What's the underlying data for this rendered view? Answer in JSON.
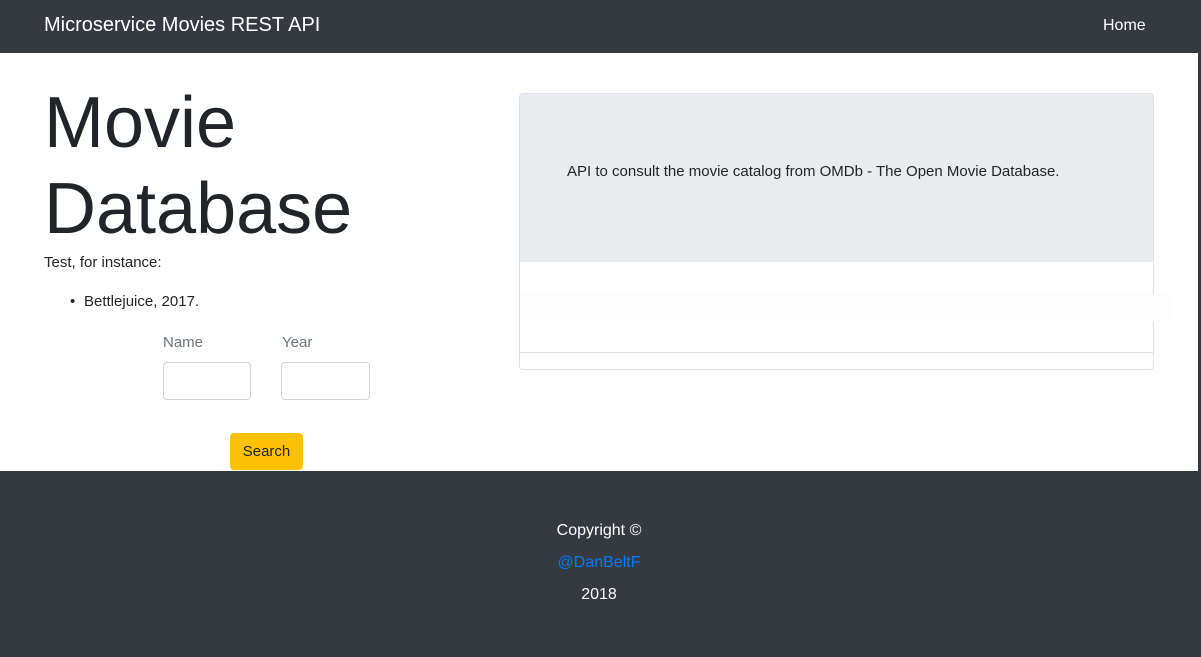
{
  "navbar": {
    "brand": "Microservice Movies REST API",
    "home_label": "Home"
  },
  "hero": {
    "title": "Movie Database",
    "intro": "Test, for instance:",
    "examples": [
      "Bettlejuice, 2017."
    ]
  },
  "form": {
    "name_label": "Name",
    "name_value": "",
    "year_label": "Year",
    "year_value": "",
    "search_label": "Search"
  },
  "panel": {
    "description": "API to consult the movie catalog from OMDb - The Open Movie Database."
  },
  "footer": {
    "copyright": "Copyright ©",
    "author_link": "@DanBeltF",
    "year": "2018"
  },
  "colors": {
    "navbar_bg": "#343a40",
    "accent_button": "#ffc107",
    "link": "#007bff",
    "jumbotron_bg": "#e9ecef"
  }
}
